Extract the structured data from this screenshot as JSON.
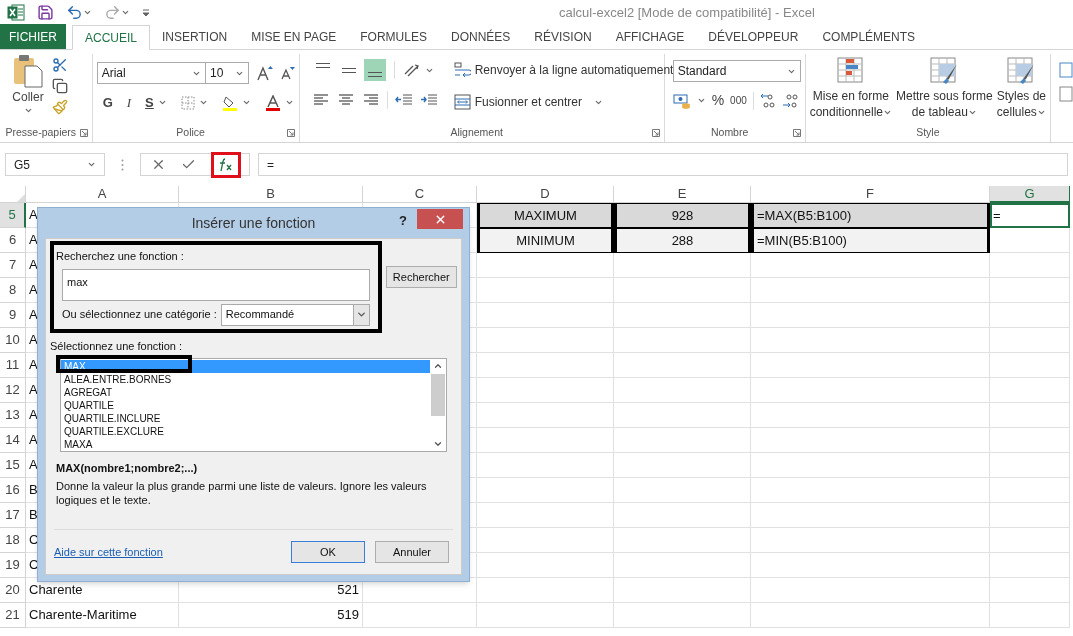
{
  "window": {
    "title": "calcul-excel2  [Mode de compatibilité] - Excel"
  },
  "ribbon_tabs": [
    {
      "label": "FICHIER",
      "kind": "file",
      "selected": false
    },
    {
      "label": "ACCUEIL",
      "kind": "tab",
      "selected": true
    },
    {
      "label": "INSERTION",
      "kind": "tab",
      "selected": false
    },
    {
      "label": "MISE EN PAGE",
      "kind": "tab",
      "selected": false
    },
    {
      "label": "FORMULES",
      "kind": "tab",
      "selected": false
    },
    {
      "label": "DONNÉES",
      "kind": "tab",
      "selected": false
    },
    {
      "label": "RÉVISION",
      "kind": "tab",
      "selected": false
    },
    {
      "label": "AFFICHAGE",
      "kind": "tab",
      "selected": false
    },
    {
      "label": "DÉVELOPPEUR",
      "kind": "tab",
      "selected": false
    },
    {
      "label": "COMPLÉMENTS",
      "kind": "tab",
      "selected": false
    }
  ],
  "ribbon": {
    "clipboard": {
      "paste_label": "Coller",
      "group_label": "Presse-papiers"
    },
    "font": {
      "name": "Arial",
      "size": "10",
      "bold": "G",
      "italic": "I",
      "underline": "S",
      "group_label": "Police"
    },
    "alignment": {
      "vertical": [
        {
          "selected": false
        },
        {
          "selected": false
        },
        {
          "selected": true
        }
      ],
      "wrap": "Renvoyer à la ligne automatiquement",
      "merge": "Fusionner et centrer",
      "group_label": "Alignement"
    },
    "number": {
      "format": "Standard",
      "percent": "%",
      "thousands": "000",
      "group_label": "Nombre"
    },
    "styles": {
      "buttons": [
        {
          "lines": [
            "Mise en forme",
            "conditionnelle"
          ]
        },
        {
          "lines": [
            "Mettre sous forme",
            "de tableau"
          ]
        },
        {
          "lines": [
            "Styles de",
            "cellules"
          ]
        }
      ],
      "group_label": "Style"
    }
  },
  "formula_bar": {
    "name_box": "G5",
    "formula": "="
  },
  "sheet": {
    "columns": [
      {
        "label": "A",
        "selected": false
      },
      {
        "label": "B",
        "selected": false
      },
      {
        "label": "C",
        "selected": false
      },
      {
        "label": "D",
        "selected": false
      },
      {
        "label": "E",
        "selected": false
      },
      {
        "label": "F",
        "selected": false
      },
      {
        "label": "G",
        "selected": true
      }
    ],
    "rows": [
      {
        "label": "5",
        "selected": true,
        "cells": {
          "a": {
            "text": "A",
            "selected": false
          },
          "d": {
            "text": "MAXIMUM",
            "kind": "summary_center_dark",
            "selected": false
          },
          "e": {
            "text": "928",
            "kind": "summary_center_dark",
            "selected": false
          },
          "f": {
            "text": "=MAX(B5:B100)",
            "kind": "summary_left_dark",
            "selected": false
          },
          "g": {
            "text": "=",
            "selected": true
          }
        }
      },
      {
        "label": "6",
        "selected": false,
        "cells": {
          "a": {
            "text": "A",
            "selected": false
          },
          "d": {
            "text": "MINIMUM",
            "kind": "summary_center_light",
            "selected": false
          },
          "e": {
            "text": "288",
            "kind": "summary_center_light",
            "selected": false
          },
          "f": {
            "text": "=MIN(B5:B100)",
            "kind": "summary_left_light",
            "selected": false
          }
        }
      },
      {
        "label": "7",
        "selected": false,
        "cells": {
          "a": {
            "text": "A",
            "selected": false
          }
        }
      },
      {
        "label": "8",
        "selected": false,
        "cells": {
          "a": {
            "text": "A",
            "selected": false
          }
        }
      },
      {
        "label": "9",
        "selected": false,
        "cells": {
          "a": {
            "text": "A",
            "selected": false
          }
        }
      },
      {
        "label": "10",
        "selected": false,
        "cells": {
          "a": {
            "text": "A",
            "selected": false
          }
        }
      },
      {
        "label": "11",
        "selected": false,
        "cells": {
          "a": {
            "text": "A",
            "selected": false
          }
        }
      },
      {
        "label": "12",
        "selected": false,
        "cells": {
          "a": {
            "text": "A",
            "selected": false
          }
        }
      },
      {
        "label": "13",
        "selected": false,
        "cells": {
          "a": {
            "text": "A",
            "selected": false
          }
        }
      },
      {
        "label": "14",
        "selected": false,
        "cells": {
          "a": {
            "text": "A",
            "selected": false
          }
        }
      },
      {
        "label": "15",
        "selected": false,
        "cells": {
          "a": {
            "text": "A",
            "selected": false
          }
        }
      },
      {
        "label": "16",
        "selected": false,
        "cells": {
          "a": {
            "text": "B",
            "selected": false
          }
        }
      },
      {
        "label": "17",
        "selected": false,
        "cells": {
          "a": {
            "text": "B",
            "selected": false
          }
        }
      },
      {
        "label": "18",
        "selected": false,
        "cells": {
          "a": {
            "text": "C",
            "selected": false
          }
        }
      },
      {
        "label": "19",
        "selected": false,
        "cells": {
          "a": {
            "text": "C",
            "selected": false
          }
        }
      },
      {
        "label": "20",
        "selected": false,
        "cells": {
          "a": {
            "text": "Charente",
            "selected": false
          },
          "b": {
            "text": "521",
            "kind": "number",
            "selected": false
          }
        }
      },
      {
        "label": "21",
        "selected": false,
        "cells": {
          "a": {
            "text": "Charente-Maritime",
            "selected": false
          },
          "b": {
            "text": "519",
            "kind": "number",
            "selected": false
          }
        }
      }
    ]
  },
  "dialog": {
    "title": "Insérer une fonction",
    "help": "?",
    "search_label": "Recherchez une fonction :",
    "search_value": "max",
    "search_button": "Rechercher",
    "category_label": "Ou sélectionnez une catégorie :",
    "category_value": "Recommandé",
    "list_label": "Sélectionnez une fonction :",
    "functions": [
      {
        "label": "MAX",
        "selected": true
      },
      {
        "label": "ALEA.ENTRE.BORNES",
        "selected": false
      },
      {
        "label": "AGREGAT",
        "selected": false
      },
      {
        "label": "QUARTILE",
        "selected": false
      },
      {
        "label": "QUARTILE.INCLURE",
        "selected": false
      },
      {
        "label": "QUARTILE.EXCLURE",
        "selected": false
      },
      {
        "label": "MAXA",
        "selected": false
      }
    ],
    "signature": "MAX(nombre1;nombre2;...)",
    "description": "Donne la valeur la plus grande parmi une liste de valeurs. Ignore les valeurs logiques et le texte.",
    "help_link": "Aide sur cette fonction",
    "ok": "OK",
    "cancel": "Annuler"
  }
}
